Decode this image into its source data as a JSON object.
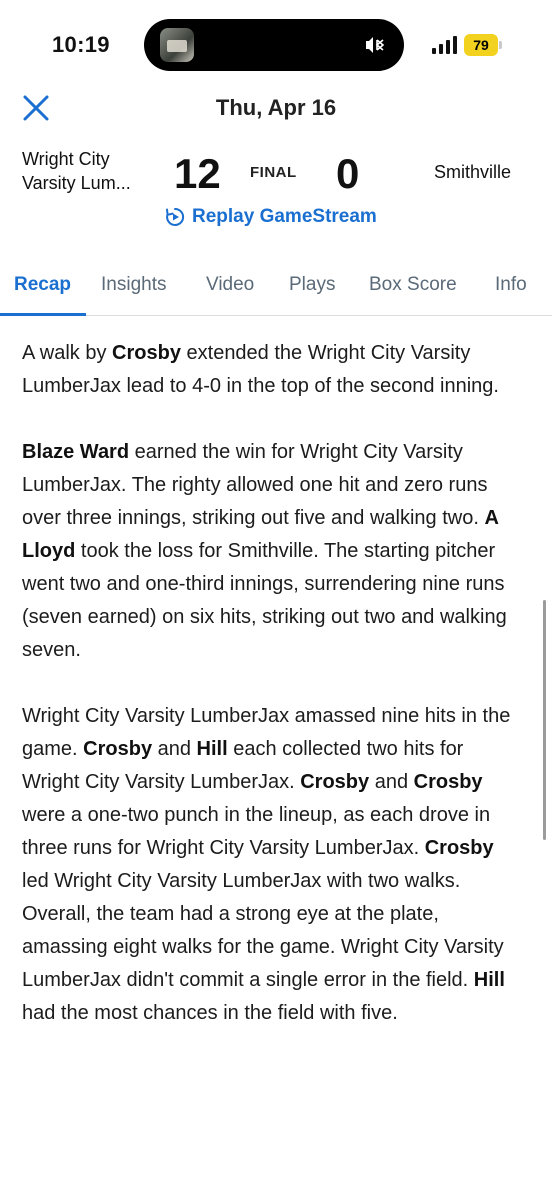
{
  "status_bar": {
    "time": "10:19",
    "battery": "79",
    "battery_color": "#f2d21f"
  },
  "header": {
    "date": "Thu, Apr 16",
    "close_icon": "close-x-icon"
  },
  "scoreboard": {
    "home_team_line1": "Wright City",
    "home_team_line2": "Varsity Lum...",
    "home_score": "12",
    "status": "FINAL",
    "away_score": "0",
    "away_team": "Smithville"
  },
  "replay": {
    "label": "Replay GameStream",
    "color": "#1a6fd0"
  },
  "tabs": [
    {
      "label": "Recap",
      "active": true
    },
    {
      "label": "Insights",
      "active": false
    },
    {
      "label": "Video",
      "active": false
    },
    {
      "label": "Plays",
      "active": false
    },
    {
      "label": "Box Score",
      "active": false
    },
    {
      "label": "Info",
      "active": false
    }
  ],
  "recap": {
    "p1": {
      "t1": "A walk by ",
      "b1": "Crosby",
      "t2": " extended the Wright City Varsity LumberJax lead to 4-0 in the top of the second inning."
    },
    "p2": {
      "b1": "Blaze Ward",
      "t1": " earned the win for Wright City Varsity LumberJax. The righty allowed one hit and zero runs over three innings, striking out five and walking two. ",
      "b2": "A Lloyd",
      "t2": " took the loss for Smithville. The starting pitcher went two and one-third innings, surrendering nine runs (seven earned) on six hits, striking out two and walking seven."
    },
    "p3": {
      "t1": "Wright City Varsity LumberJax amassed nine hits in the game. ",
      "b1": "Crosby",
      "t2": " and ",
      "b2": "Hill",
      "t3": " each collected two hits for Wright City Varsity LumberJax. ",
      "b3": "Crosby",
      "t4": " and ",
      "b4": "Crosby",
      "t5": " were a one-two punch in the lineup, as each drove in three runs for Wright City Varsity LumberJax. ",
      "b5": "Crosby",
      "t6": " led Wright City Varsity LumberJax with two walks. Overall, the team had a strong eye at the plate, amassing eight walks for the game. Wright City Varsity LumberJax didn't commit a single error in the field. ",
      "b6": "Hill",
      "t7": " had the most chances in the field with five."
    }
  }
}
